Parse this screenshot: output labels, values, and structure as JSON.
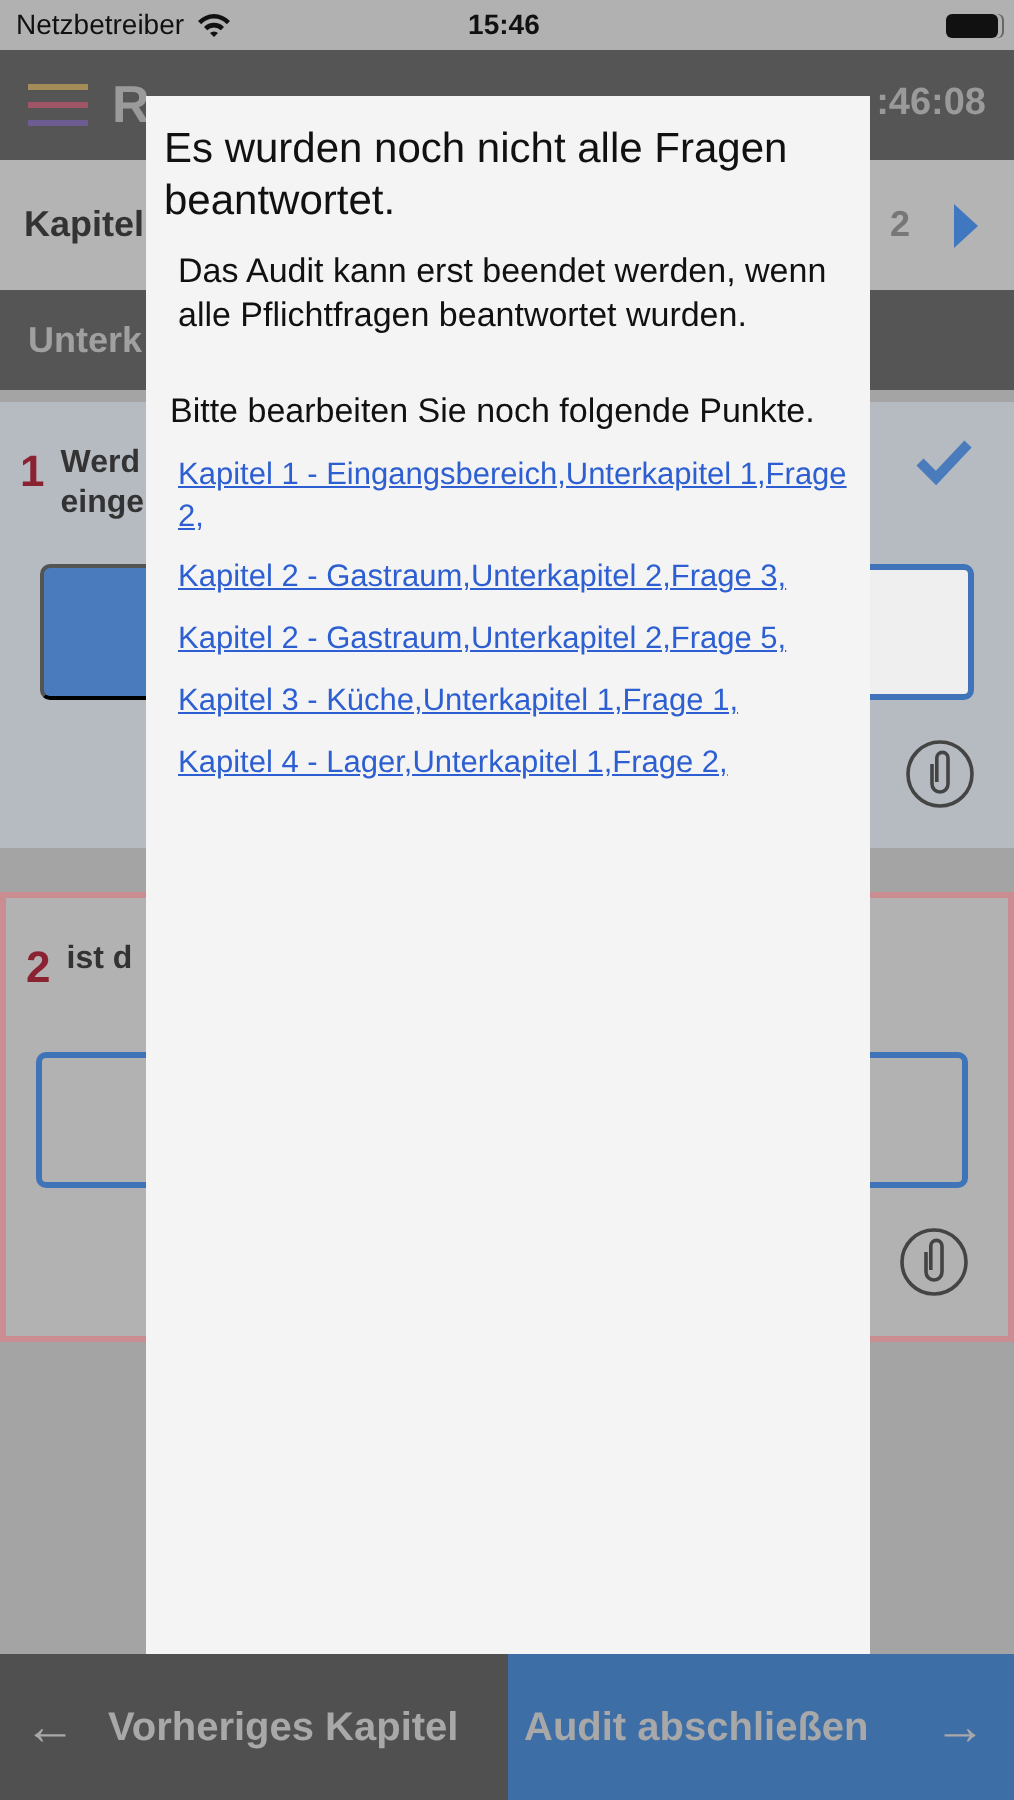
{
  "status_bar": {
    "carrier": "Netzbetreiber",
    "time": "15:46"
  },
  "header": {
    "title": "R",
    "timestamp": ":46:08"
  },
  "chapter_bar": {
    "label": "Kapitel",
    "number": "2"
  },
  "subchapter_bar": {
    "label": "Unterk"
  },
  "questions": [
    {
      "number": "1",
      "text_lines": [
        "Werd",
        "einge"
      ],
      "answered": true,
      "kind": "choice",
      "options": [
        {
          "selected": true
        },
        {
          "selected": false
        }
      ]
    },
    {
      "number": "2",
      "text_lines": [
        "ist d"
      ],
      "answered": false,
      "kind": "input"
    }
  ],
  "dialog": {
    "title": "Es wurden noch nicht alle Fragen beantwortet.",
    "message": "Das Audit kann erst beendet werden, wenn alle Pflichtfragen beantwortet wurden.",
    "prompt": "Bitte bearbeiten Sie noch folgende Punkte.",
    "links": [
      "Kapitel 1 - Eingangsbereich,Unterkapitel 1,Frage 2,",
      "Kapitel 2 - Gastraum,Unterkapitel 2,Frage 3,",
      "Kapitel 2 - Gastraum,Unterkapitel 2,Frage 5,",
      "Kapitel 3 - Küche,Unterkapitel 1,Frage 1,",
      "Kapitel 4 - Lager,Unterkapitel 1,Frage 2,"
    ]
  },
  "footer": {
    "previous": {
      "arrow": "←",
      "label": "Vorheriges Kapitel"
    },
    "next": {
      "label": "Audit abschließen",
      "arrow": "→"
    }
  }
}
